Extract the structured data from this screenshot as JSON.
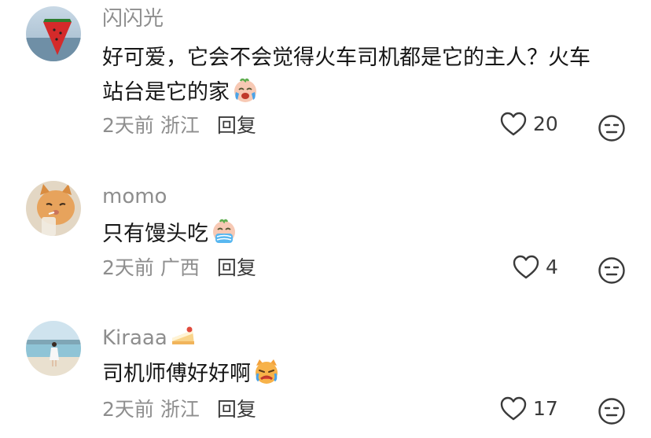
{
  "comments": [
    {
      "username": "闪闪光",
      "text_line1": "好可爱，它会不会觉得火车司机都是它的主人？火车",
      "text_line2": "站台是它的家",
      "emoji": "crying-face-emoji",
      "time": "2天前",
      "location": "浙江",
      "reply_label": "回复",
      "likes": "20",
      "avatar": "watermelon-avatar"
    },
    {
      "username": "momo",
      "text": "只有馒头吃",
      "emoji": "crying-face-emoji",
      "time": "2天前",
      "location": "广西",
      "reply_label": "回复",
      "likes": "4",
      "avatar": "cat-avatar"
    },
    {
      "username": "Kiraaa",
      "badge": "cake-icon",
      "text": "司机师傅好好啊",
      "emoji": "crying-cat-emoji",
      "time": "2天前",
      "location": "浙江",
      "reply_label": "回复",
      "likes": "17",
      "avatar": "beach-avatar"
    }
  ],
  "colors": {
    "meta_gray": "#8e8e8e",
    "text_dark": "#161616"
  }
}
